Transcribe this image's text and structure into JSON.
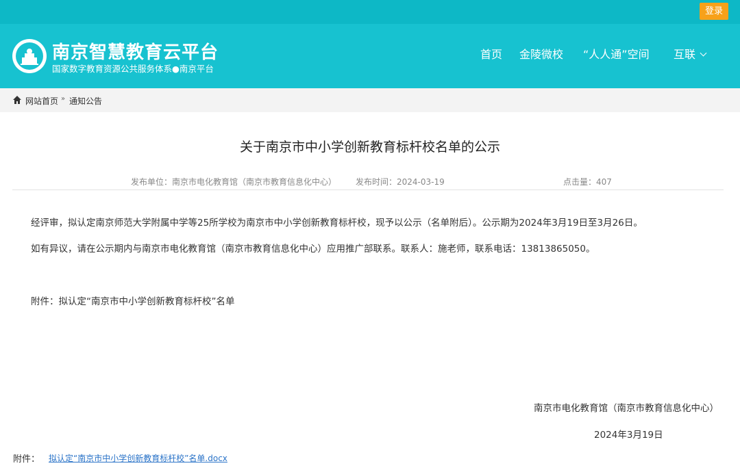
{
  "topbar": {
    "login_label": "登录"
  },
  "header": {
    "logo_title": "南京智慧教育云平台",
    "logo_subtitle": "国家数字教育资源公共服务体系●南京平台",
    "nav": [
      {
        "label": "首页"
      },
      {
        "label": "金陵微校"
      },
      {
        "label": "“人人通”空间"
      },
      {
        "label": "互联"
      }
    ]
  },
  "breadcrumb": {
    "home": "网站首页",
    "separator": "»",
    "current": "通知公告"
  },
  "article": {
    "title": "关于南京市中小学创新教育标杆校名单的公示",
    "meta": {
      "publisher": "发布单位：南京市电化教育馆（南京市教育信息化中心）",
      "publish_time": "发布时间：2024-03-19",
      "views": "点击量：407"
    },
    "paragraphs": [
      "经评审，拟认定南京师范大学附属中学等25所学校为南京市中小学创新教育标杆校，现予以公示（名单附后）。公示期为2024年3月19日至3月26日。",
      "如有异议，请在公示期内与南京市电化教育馆（南京市教育信息化中心）应用推广部联系。联系人：施老师，联系电话：13813865050。",
      "附件：拟认定“南京市中小学创新教育标杆校”名单"
    ],
    "signature": "南京市电化教育馆（南京市教育信息化中心）",
    "date": "2024年3月19日"
  },
  "attachment": {
    "label": "附件：",
    "file_name": "拟认定“南京市中小学创新教育标杆校”名单.docx"
  },
  "colors": {
    "primary": "#17c2d0",
    "topbar": "#0db8c6",
    "login": "#f7a11a",
    "link": "#2a73c8"
  }
}
